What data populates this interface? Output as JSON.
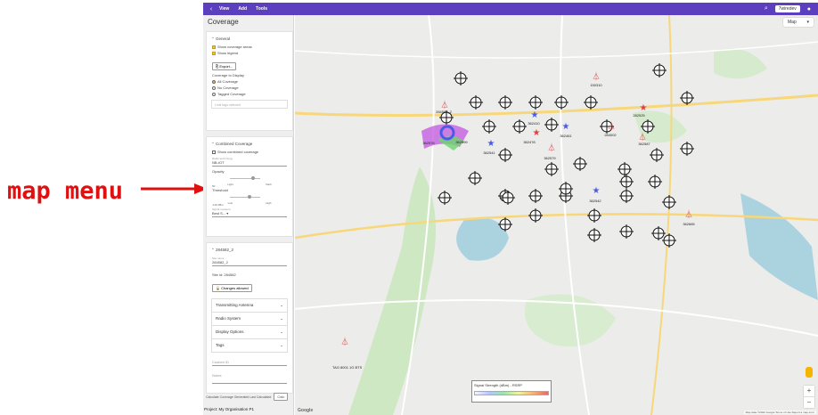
{
  "annotation": {
    "label": "map menu"
  },
  "topbar": {
    "menu": [
      "View",
      "Add",
      "Tools"
    ],
    "logo": "7wiredev"
  },
  "panel": {
    "title": "Coverage",
    "general": {
      "heading": "General",
      "show_coverage_areas": "Show coverage areas",
      "show_legend": "Show legend",
      "export": "Export...",
      "display_label": "Coverage to Display",
      "options": [
        "All Coverage",
        "No Coverage",
        "Tagged Coverage"
      ],
      "tags_placeholder": "Limit tags selected"
    },
    "combined": {
      "heading": "Combined Coverage",
      "show_combined": "Show combined coverage",
      "technology_label": "Radio technology",
      "technology_value": "NB-IOT",
      "opacity_label": "Opacity",
      "opacity_value": "50",
      "opacity_light": "Light",
      "opacity_dark": "Dark",
      "threshold_label": "Threshold",
      "threshold_value": "-116 dBm",
      "threshold_low": "Low",
      "threshold_high": "High",
      "select_label": "Signal measure",
      "select_value": "Best S..."
    },
    "site": {
      "heading": "284582_2",
      "name_hint": "Site name",
      "name_value": "284582_2",
      "site_id": "Site id: 284582",
      "changes_button": "Changes allowed",
      "sections": [
        "Transmitting Antenna",
        "Radio System",
        "Display Options",
        "Tags"
      ],
      "custom_id": "Custom ID",
      "notes": "Notes"
    },
    "footer": "Calculate Coverage  Generated  Last Calculated",
    "footer_button": "Calc"
  },
  "map": {
    "type_label": "Map",
    "legend_title": "Signal Strength (dBm) - RSRP",
    "zoom_in": "+",
    "zoom_out": "−",
    "attribution": "Map data ©2022 Google   Terms of Use   Report a map error",
    "site_labels": [
      "150310",
      "282525",
      "284002",
      "284582_2",
      "362410",
      "362461",
      "362478",
      "362541",
      "362542",
      "362576",
      "362579",
      "362587",
      "362599",
      "362665"
    ],
    "bottom_label": "TAG 8001 1G BTS"
  },
  "status": {
    "text": "Project: My Organisation P1"
  },
  "colors": {
    "topbar": "#5b3fbf",
    "arrow": "#e11010",
    "star_blue": "#4b5be8",
    "star_red": "#e14040"
  }
}
